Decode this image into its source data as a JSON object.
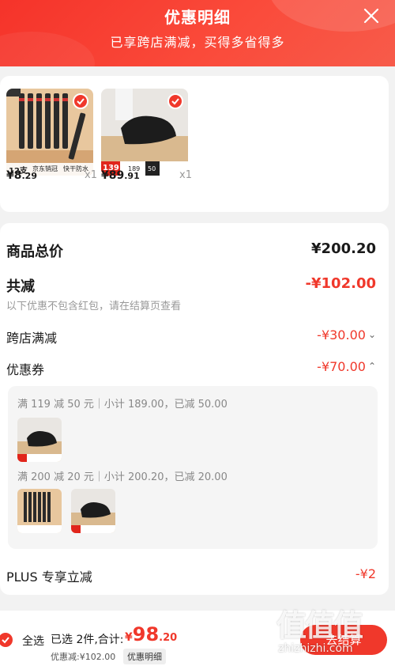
{
  "header": {
    "title": "优惠明细",
    "subtitle": "已享跨店满减，买得多省得多"
  },
  "products": [
    {
      "name": "pen-set",
      "image_text": [
        "12支",
        "京东销冠",
        "快干防水"
      ],
      "price_int": "¥8",
      "price_dec": ".29",
      "qty": "x1"
    },
    {
      "name": "shoes",
      "image_text": [
        "139",
        "189",
        "50"
      ],
      "price_int": "¥89",
      "price_dec": ".91",
      "qty": "x1"
    }
  ],
  "summary": {
    "total_label": "商品总价",
    "total_value": "¥200.20",
    "reduce_label": "共减",
    "reduce_value": "-¥102.00",
    "note": "以下优惠不包含红包，请在结算页查看",
    "cross_store_label": "跨店满减",
    "cross_store_value": "-¥30.00",
    "coupon_label": "优惠券",
    "coupon_value": "-¥70.00",
    "plus_label": "PLUS 专享立减",
    "plus_value": "-¥2"
  },
  "coupons": [
    {
      "text": "满 119 减 50 元｜小计 189.00，已减 50.00"
    },
    {
      "text": "满 200 减 20 元｜小计 200.20，已减 20.00"
    }
  ],
  "bottom": {
    "select_all": "全选",
    "selected": "已选 2件,合计:",
    "currency": "¥",
    "price_big": "98",
    "price_dec": ".20",
    "discount_line": "优惠减:¥102.00",
    "detail_tag": "优惠明细",
    "checkout": "去结算"
  },
  "watermark": {
    "glyphs": "值值值",
    "text": "zhizhizhi.com"
  },
  "colors": {
    "accent": "#f0382b",
    "header_start": "#f5332a",
    "header_end": "#f75b4a"
  }
}
